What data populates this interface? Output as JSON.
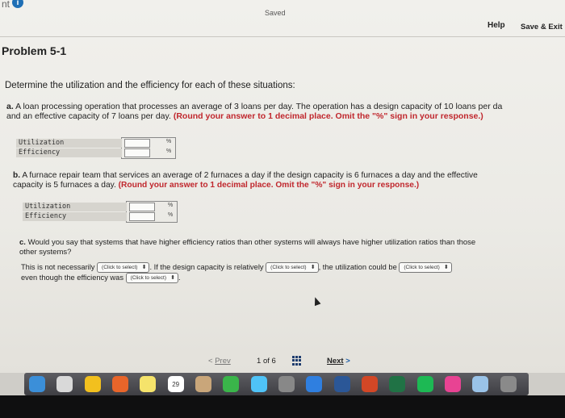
{
  "header": {
    "tab_label": "nt",
    "info_icon_label": "i",
    "saved_label": "Saved",
    "help_label": "Help",
    "save_exit_label": "Save & Exit"
  },
  "problem": {
    "title": "Problem 5-1",
    "instructions": "Determine the utilization and the efficiency for each of these situations:"
  },
  "part_a": {
    "lead": "a.",
    "line1": "A loan processing operation that processes an average of 3 loans per day. The operation has a design capacity of 10 loans per da",
    "line2": "and an effective capacity of 7 loans per day.",
    "round_note": "(Round your answer to 1 decimal place. Omit the \"%\" sign in your response.)",
    "rows": [
      {
        "label": "Utilization",
        "value": "",
        "unit": "%"
      },
      {
        "label": "Efficiency",
        "value": "",
        "unit": "%"
      }
    ]
  },
  "part_b": {
    "lead": "b.",
    "line1": "A furnace repair team that services an average of 2 furnaces a day if the design capacity is 6 furnaces a day and the effective",
    "line2": "capacity is 5 furnaces a day.",
    "round_note": "(Round your answer to 1 decimal place. Omit the \"%\" sign in your response.)",
    "rows": [
      {
        "label": "Utilization",
        "value": "",
        "unit": "%"
      },
      {
        "label": "Efficiency",
        "value": "",
        "unit": "%"
      }
    ]
  },
  "part_c": {
    "lead": "c.",
    "line1": "Would you say that systems that have higher efficiency ratios than other systems will always have higher utilization ratios than those",
    "line2": "other systems?",
    "ans1_pre": "This is not necessarily",
    "ans1_mid": ". If the design capacity is relatively",
    "ans1_post": ", the utilization could be",
    "ans2_pre": "even though the efficiency was",
    "select_placeholder": "(Click to select)",
    "select_arrow": "⬍"
  },
  "pagination": {
    "prev_arrow": "<",
    "prev_label": "Prev",
    "current_page": "1",
    "of_label": "of",
    "total_pages": "6",
    "next_label": "Next",
    "next_arrow": ">"
  },
  "dock": {
    "calendar_day": "29",
    "icons": [
      "finder-icon",
      "launchpad-icon",
      "chrome-icon",
      "photos-icon",
      "notes-icon",
      "calendar-icon",
      "contacts-icon",
      "facetime-icon",
      "messages-icon",
      "system-icon",
      "app-store-icon",
      "word-icon",
      "powerpoint-icon",
      "excel-icon",
      "spotify-icon",
      "itunes-icon",
      "preview-icon",
      "trash-icon"
    ],
    "colors": [
      "#3b8fd9",
      "#d9d9d9",
      "#f2c01e",
      "#e8652a",
      "#f5e36b",
      "#ffffff",
      "#c9a67a",
      "#3ab54a",
      "#4fc3f7",
      "#888888",
      "#2f7fe0",
      "#2b5797",
      "#d24726",
      "#207245",
      "#1db954",
      "#e84393",
      "#9ac3e8",
      "#8a8a8a"
    ]
  }
}
